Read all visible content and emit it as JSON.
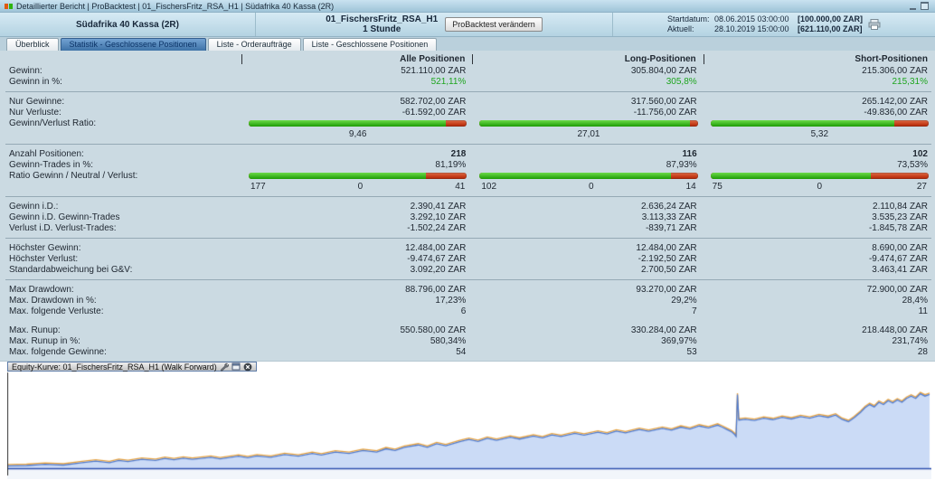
{
  "titlebar": {
    "title": "Detaillierter Bericht | ProBacktest | 01_FischersFritz_RSA_H1 | Südafrika 40 Kassa (2R)"
  },
  "header": {
    "instrument": "Südafrika 40 Kassa (2R)",
    "strategy": "01_FischersFritz_RSA_H1",
    "timeframe": "1 Stunde",
    "button_label": "ProBacktest verändern",
    "start_label": "Startdatum:",
    "start_datetime": "08.06.2015 03:00:00",
    "start_amount": "[100.000,00 ZAR]",
    "aktuell_label": "Aktuell:",
    "aktuell_datetime": "28.10.2019 15:00:00",
    "aktuell_amount": "[621.110,00 ZAR]"
  },
  "tabs": [
    {
      "label": "Überblick",
      "active": false
    },
    {
      "label": "Statistik - Geschlossene Positionen",
      "active": true
    },
    {
      "label": "Liste - Orderaufträge",
      "active": false
    },
    {
      "label": "Liste - Geschlossene Positionen",
      "active": false
    }
  ],
  "stats": {
    "columns": [
      "Alle Positionen",
      "Long-Positionen",
      "Short-Positionen"
    ],
    "rows": [
      {
        "type": "values",
        "label": "Gewinn:",
        "values": [
          "521.110,00 ZAR",
          "305.804,00 ZAR",
          "215.306,00 ZAR"
        ]
      },
      {
        "type": "values",
        "label": "Gewinn in %:",
        "style": "green",
        "values": [
          "521,11%",
          "305,8%",
          "215,31%"
        ]
      },
      {
        "type": "separator"
      },
      {
        "type": "values",
        "label": "Nur Gewinne:",
        "values": [
          "582.702,00 ZAR",
          "317.560,00 ZAR",
          "265.142,00 ZAR"
        ]
      },
      {
        "type": "values",
        "label": "Nur Verluste:",
        "values": [
          "-61.592,00 ZAR",
          "-11.756,00 ZAR",
          "-49.836,00 ZAR"
        ]
      },
      {
        "type": "ratio_bar",
        "label": "Gewinn/Verlust Ratio:",
        "bars": [
          {
            "green_pct": 90.4,
            "value": "9,46"
          },
          {
            "green_pct": 96.4,
            "value": "27,01"
          },
          {
            "green_pct": 84.2,
            "value": "5,32"
          }
        ]
      },
      {
        "type": "separator"
      },
      {
        "type": "values",
        "label": "Anzahl Positionen:",
        "style": "bold",
        "values": [
          "218",
          "116",
          "102"
        ]
      },
      {
        "type": "values",
        "label": "Gewinn-Trades in %:",
        "values": [
          "81,19%",
          "87,93%",
          "73,53%"
        ]
      },
      {
        "type": "triple_bar",
        "label": "Ratio Gewinn / Neutral / Verlust:",
        "bars": [
          {
            "green_pct": 81.2,
            "win": "177",
            "neutral": "0",
            "loss": "41"
          },
          {
            "green_pct": 87.9,
            "win": "102",
            "neutral": "0",
            "loss": "14"
          },
          {
            "green_pct": 73.5,
            "win": "75",
            "neutral": "0",
            "loss": "27"
          }
        ]
      },
      {
        "type": "separator"
      },
      {
        "type": "values",
        "label": "Gewinn i.D.:",
        "values": [
          "2.390,41 ZAR",
          "2.636,24 ZAR",
          "2.110,84 ZAR"
        ]
      },
      {
        "type": "values",
        "label": "Gewinn i.D. Gewinn-Trades",
        "values": [
          "3.292,10 ZAR",
          "3.113,33 ZAR",
          "3.535,23 ZAR"
        ]
      },
      {
        "type": "values",
        "label": "Verlust i.D. Verlust-Trades:",
        "values": [
          "-1.502,24 ZAR",
          "-839,71 ZAR",
          "-1.845,78 ZAR"
        ]
      },
      {
        "type": "separator"
      },
      {
        "type": "values",
        "label": "Höchster Gewinn:",
        "values": [
          "12.484,00 ZAR",
          "12.484,00 ZAR",
          "8.690,00 ZAR"
        ]
      },
      {
        "type": "values",
        "label": "Höchster Verlust:",
        "values": [
          "-9.474,67 ZAR",
          "-2.192,50 ZAR",
          "-9.474,67 ZAR"
        ]
      },
      {
        "type": "values",
        "label": "Standardabweichung bei G&V:",
        "values": [
          "3.092,20 ZAR",
          "2.700,50 ZAR",
          "3.463,41 ZAR"
        ]
      },
      {
        "type": "separator"
      },
      {
        "type": "values",
        "label": "Max Drawdown:",
        "values": [
          "88.796,00 ZAR",
          "93.270,00 ZAR",
          "72.900,00 ZAR"
        ]
      },
      {
        "type": "values",
        "label": "Max. Drawdown in %:",
        "values": [
          "17,23%",
          "29,2%",
          "28,4%"
        ]
      },
      {
        "type": "values",
        "label": "Max. folgende Verluste:",
        "values": [
          "6",
          "7",
          "11"
        ]
      },
      {
        "type": "spacer"
      },
      {
        "type": "values",
        "label": "Max. Runup:",
        "values": [
          "550.580,00 ZAR",
          "330.284,00 ZAR",
          "218.448,00 ZAR"
        ]
      },
      {
        "type": "values",
        "label": "Max. Runup in %:",
        "values": [
          "580,34%",
          "369,97%",
          "231,74%"
        ]
      },
      {
        "type": "values",
        "label": "Max. folgende Gewinne:",
        "values": [
          "54",
          "53",
          "28"
        ]
      }
    ]
  },
  "equity": {
    "title": "Equity-Kurve: 01_FischersFritz_RSA_H1 (Walk Forward)"
  },
  "chart_data": {
    "type": "area",
    "title": "Equity-Kurve: 01_FischersFritz_RSA_H1 (Walk Forward)",
    "x_range": [
      "08.06.2015 03:00:00",
      "28.10.2019 15:00:00"
    ],
    "y_start_zar": 100000,
    "y_end_zar": 621110,
    "unit": "ZAR (point y-values in thousands)",
    "line_color": "#4f7bd0",
    "overlay_color": "#e8a23c",
    "fill_color": "#cbdbf6",
    "baseline_color": "#2c4fae",
    "legend_position": "none",
    "grid": false,
    "series": [
      {
        "name": "Equity (Walk Forward)",
        "points": [
          [
            0.0,
            97
          ],
          [
            0.02,
            100
          ],
          [
            0.04,
            108
          ],
          [
            0.06,
            103
          ],
          [
            0.08,
            119
          ],
          [
            0.095,
            130
          ],
          [
            0.11,
            119
          ],
          [
            0.12,
            135
          ],
          [
            0.13,
            127
          ],
          [
            0.145,
            143
          ],
          [
            0.16,
            135
          ],
          [
            0.17,
            149
          ],
          [
            0.18,
            140
          ],
          [
            0.19,
            151
          ],
          [
            0.2,
            143
          ],
          [
            0.22,
            157
          ],
          [
            0.23,
            146
          ],
          [
            0.25,
            165
          ],
          [
            0.26,
            154
          ],
          [
            0.27,
            167
          ],
          [
            0.285,
            157
          ],
          [
            0.3,
            176
          ],
          [
            0.315,
            165
          ],
          [
            0.33,
            184
          ],
          [
            0.34,
            173
          ],
          [
            0.355,
            194
          ],
          [
            0.37,
            184
          ],
          [
            0.385,
            205
          ],
          [
            0.4,
            194
          ],
          [
            0.41,
            216
          ],
          [
            0.42,
            205
          ],
          [
            0.43,
            227
          ],
          [
            0.445,
            243
          ],
          [
            0.455,
            227
          ],
          [
            0.465,
            251
          ],
          [
            0.475,
            238
          ],
          [
            0.49,
            265
          ],
          [
            0.5,
            281
          ],
          [
            0.51,
            267
          ],
          [
            0.52,
            289
          ],
          [
            0.53,
            275
          ],
          [
            0.545,
            297
          ],
          [
            0.555,
            284
          ],
          [
            0.57,
            305
          ],
          [
            0.58,
            292
          ],
          [
            0.59,
            313
          ],
          [
            0.6,
            302
          ],
          [
            0.615,
            324
          ],
          [
            0.625,
            311
          ],
          [
            0.64,
            332
          ],
          [
            0.65,
            319
          ],
          [
            0.66,
            340
          ],
          [
            0.67,
            327
          ],
          [
            0.685,
            351
          ],
          [
            0.695,
            338
          ],
          [
            0.71,
            359
          ],
          [
            0.72,
            346
          ],
          [
            0.73,
            367
          ],
          [
            0.74,
            354
          ],
          [
            0.75,
            375
          ],
          [
            0.76,
            362
          ],
          [
            0.77,
            381
          ],
          [
            0.775,
            367
          ],
          [
            0.78,
            351
          ],
          [
            0.785,
            335
          ],
          [
            0.788,
            319
          ],
          [
            0.79,
            302
          ],
          [
            0.7915,
            594
          ],
          [
            0.793,
            416
          ],
          [
            0.8,
            421
          ],
          [
            0.81,
            413
          ],
          [
            0.82,
            429
          ],
          [
            0.83,
            419
          ],
          [
            0.84,
            435
          ],
          [
            0.85,
            424
          ],
          [
            0.86,
            440
          ],
          [
            0.87,
            429
          ],
          [
            0.88,
            446
          ],
          [
            0.89,
            435
          ],
          [
            0.898,
            451
          ],
          [
            0.905,
            421
          ],
          [
            0.912,
            405
          ],
          [
            0.918,
            432
          ],
          [
            0.925,
            470
          ],
          [
            0.93,
            502
          ],
          [
            0.935,
            524
          ],
          [
            0.94,
            508
          ],
          [
            0.945,
            540
          ],
          [
            0.95,
            524
          ],
          [
            0.955,
            551
          ],
          [
            0.96,
            535
          ],
          [
            0.965,
            556
          ],
          [
            0.97,
            540
          ],
          [
            0.975,
            567
          ],
          [
            0.98,
            583
          ],
          [
            0.985,
            567
          ],
          [
            0.99,
            599
          ],
          [
            0.995,
            583
          ],
          [
            1.0,
            594
          ]
        ]
      }
    ]
  }
}
